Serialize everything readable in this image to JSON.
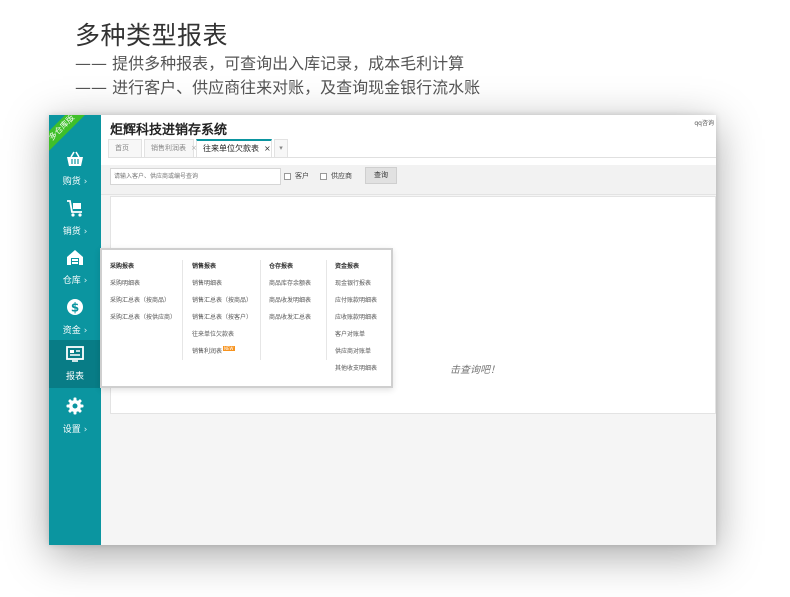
{
  "promo": {
    "title": "多种类型报表",
    "line1": "—— 提供多种报表，可查询出入库记录，成本毛利计算",
    "line2": "—— 进行客户、供应商往来对账，及查询现金银行流水账"
  },
  "app": {
    "title": "炬辉科技进销存系统",
    "qq": "qq咨询",
    "badge": "多仓库版",
    "accent": "#0b95a0"
  },
  "sidebar": {
    "items": [
      {
        "label": "购货",
        "icon": "basket-icon"
      },
      {
        "label": "销货",
        "icon": "cart-icon"
      },
      {
        "label": "仓库",
        "icon": "warehouse-icon"
      },
      {
        "label": "资金",
        "icon": "dollar-icon"
      },
      {
        "label": "报表",
        "icon": "report-icon",
        "active": true
      },
      {
        "label": "设置",
        "icon": "gear-icon"
      }
    ]
  },
  "tabs": {
    "home": "首页",
    "sales_profit": "销售利润表",
    "active": "往来单位欠款表"
  },
  "search": {
    "placeholder": "请输入客户、供应商或编号查询",
    "customer": "客户",
    "supplier": "供应商",
    "query": "查询"
  },
  "content": {
    "hint": "击查询吧！"
  },
  "menu": {
    "columns": [
      {
        "head": "采购报表",
        "items": [
          "采购明细表",
          "采购汇总表（按商品）",
          "采购汇总表（按供应商）"
        ]
      },
      {
        "head": "销售报表",
        "items": [
          "销售明细表",
          "销售汇总表（按商品）",
          "销售汇总表（按客户）",
          "往来单位欠款表",
          "销售利润表"
        ]
      },
      {
        "head": "仓存报表",
        "items": [
          "商品库存余额表",
          "商品收发明细表",
          "商品收发汇总表"
        ]
      },
      {
        "head": "资金报表",
        "items": [
          "现金银行报表",
          "应付账款明细表",
          "应收账款明细表",
          "客户对账单",
          "供应商对账单",
          "其他收支明细表"
        ]
      }
    ],
    "new_badge": "NEW"
  }
}
